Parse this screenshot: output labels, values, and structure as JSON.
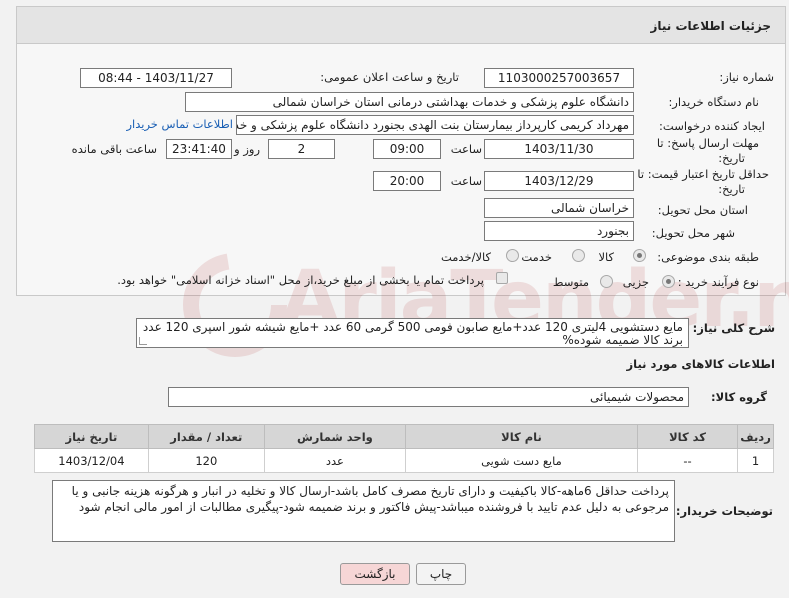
{
  "panel": {
    "title": "جزئیات اطلاعات نیاز"
  },
  "fields": {
    "need_number_label": "شماره نیاز:",
    "need_number": "1103000257003657",
    "announce_label": "تاریخ و ساعت اعلان عمومی:",
    "announce_value": "1403/11/27 - 08:44",
    "buyer_org_label": "نام دستگاه خریدار:",
    "buyer_org": "دانشگاه علوم پزشکی و خدمات بهداشتی درمانی استان خراسان شمالی",
    "creator_label": "ایجاد کننده درخواست:",
    "creator": "مهرداد کریمی کارپرداز بیمارستان بنت الهدی بجنورد دانشگاه علوم پزشکی و خد",
    "contact_link": "اطلاعات تماس خریدار",
    "reply_deadline_label_1": "مهلت ارسال پاسخ: تا",
    "reply_deadline_label_2": "تاریخ:",
    "reply_date": "1403/11/30",
    "time_label": "ساعت",
    "reply_time": "09:00",
    "days_value": "2",
    "days_label": "روز و",
    "remaining_time": "23:41:40",
    "remaining_label": "ساعت باقی مانده",
    "validity_label_1": "حداقل تاریخ اعتبار قیمت: تا",
    "validity_label_2": "تاریخ:",
    "validity_date": "1403/12/29",
    "validity_time_label": "ساعت",
    "validity_time": "20:00",
    "province_label": "استان محل تحویل:",
    "province": "خراسان شمالی",
    "city_label": "شهر محل تحویل:",
    "city": "بجنورد",
    "category_label": "طبقه بندی موضوعی:",
    "category_options": [
      "کالا",
      "خدمت",
      "کالا/خدمت"
    ],
    "process_label": "نوع فرآیند خرید :",
    "process_options": [
      "جزیی",
      "متوسط"
    ],
    "payment_note": "پرداخت تمام یا بخشی از مبلغ خرید،از محل \"اسناد خزانه اسلامی\" خواهد بود."
  },
  "summary": {
    "label": "شرح کلی نیاز:",
    "text": "مایع دستشویی 4لیتری 120 عدد+مایع صابون فومی 500 گرمی 60 عدد  +مایع شیشه شور اسپری 120 عدد برند کالا ضمیمه شوده%"
  },
  "goods": {
    "section_title": "اطلاعات کالاهای مورد نیاز",
    "group_label": "گروه کالا:",
    "group_value": "محصولات شیمیائی",
    "columns": [
      "ردیف",
      "کد کالا",
      "نام کالا",
      "واحد شمارش",
      "تعداد / مقدار",
      "تاریخ نیاز"
    ],
    "rows": [
      {
        "index": "1",
        "code": "--",
        "name": "مایع دست شویی",
        "unit": "عدد",
        "qty": "120",
        "date": "1403/12/04"
      }
    ]
  },
  "buyer_notes": {
    "label": "توضیحات خریدار:",
    "text": "پرداخت حداقل 6ماهه-کالا باکیفیت و دارای تاریخ مصرف کامل باشد-ارسال کالا و تخلیه در انبار و هرگونه هزینه جانبی و یا مرجوعی به دلیل عدم تایید با فروشنده میباشد-پیش فاکتور و برند ضمیمه شود-پیگیری مطالبات از امور مالی انجام شود"
  },
  "buttons": {
    "print": "چاپ",
    "back": "بازگشت"
  },
  "watermark": "AriaTender.neT",
  "colors": {
    "link": "#1a5fb4",
    "back_button_bg": "#f6d6d6",
    "table_header_bg": "#d6d6d6"
  }
}
